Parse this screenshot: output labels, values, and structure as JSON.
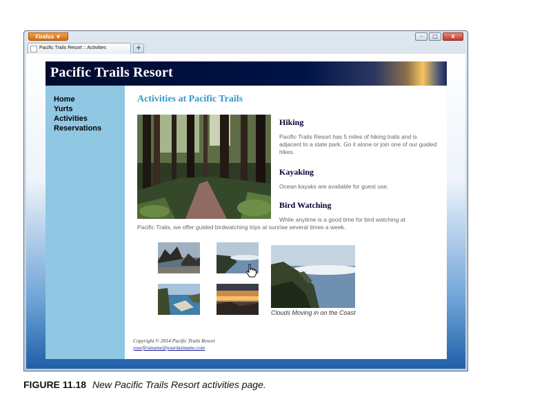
{
  "browser": {
    "app_button": "Firefox ▼",
    "tab_title": "Pacific Trails Resort :: Activities",
    "new_tab": "+",
    "window_controls": {
      "minimize": "–",
      "maximize": "□",
      "close": "x"
    }
  },
  "site": {
    "title": "Pacific Trails Resort"
  },
  "nav": {
    "items": [
      "Home",
      "Yurts",
      "Activities",
      "Reservations"
    ]
  },
  "main": {
    "heading": "Activities at Pacific Trails",
    "sections": [
      {
        "heading": "Hiking",
        "text": "Pacific Trails Resort has 5 miles of hiking trails and is adjacent to a state park. Go it alone or join one of our guided hikes."
      },
      {
        "heading": "Kayaking",
        "text": "Ocean kayaks are available for guest use."
      },
      {
        "heading": "Bird Watching",
        "text_line1": "While anytime is a good time for bird watching at",
        "text_line2": "Pacific Trails, we offer guided birdwatching trips at sunrise several times a week."
      }
    ],
    "gallery": {
      "thumbnails": [
        "coast rocks",
        "sea clouds",
        "cove",
        "sunset"
      ],
      "caption": "Clouds Moving in on the Coast"
    }
  },
  "footer": {
    "copyright": "Copyright © 2014 Pacific Trails Resort",
    "email": "yourfirstname@yourlastname.com"
  },
  "figure": {
    "label": "FIGURE 11.18",
    "caption": "New Pacific Trails Resort activities page."
  },
  "colors": {
    "nav_background": "#90c7e3",
    "content_heading": "#3399cc",
    "section_heading": "#000033",
    "body_text": "#666666",
    "header_background": "#000a2e"
  },
  "icons": {
    "cursor": "hand-pointer-icon"
  }
}
